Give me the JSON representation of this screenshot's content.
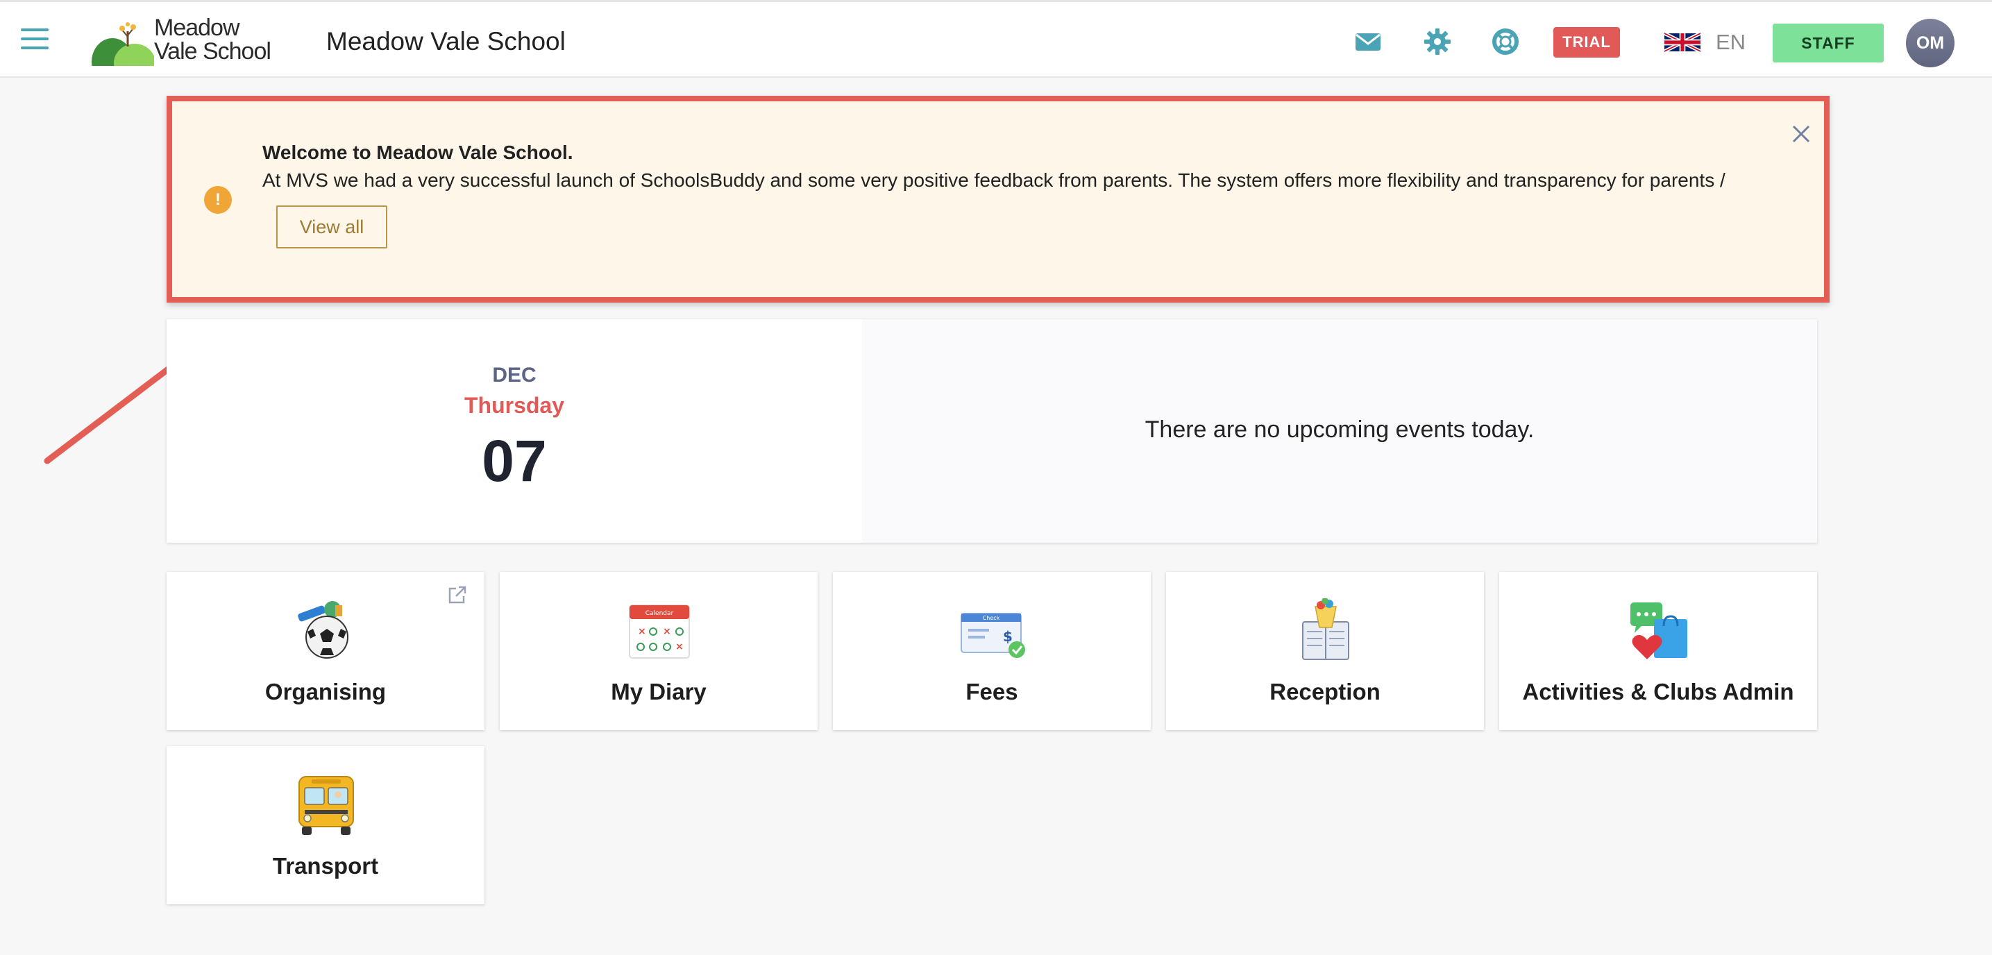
{
  "header": {
    "logo_line1": "Meadow",
    "logo_line2": "Vale School",
    "school_name": "Meadow Vale School",
    "icons": [
      "envelope-icon",
      "gear-icon",
      "lifebuoy-icon"
    ],
    "trial_label": "TRIAL",
    "language_flag": "uk-flag-icon",
    "language_code": "EN",
    "staff_label": "STAFF",
    "avatar_initials": "OM"
  },
  "banner": {
    "title": "Welcome to Meadow Vale School.",
    "text": "At MVS we had a very successful launch of SchoolsBuddy and some very positive feedback from parents. The system offers more flexibility and transparency for parents /",
    "view_all_label": "View all",
    "warning_icon_glyph": "!"
  },
  "date_panel": {
    "month": "DEC",
    "weekday": "Thursday",
    "day": "07",
    "events_message": "There are no upcoming events today."
  },
  "tiles": [
    {
      "label": "Organising",
      "icon": "sports-ball-icon"
    },
    {
      "label": "My Diary",
      "icon": "calendar-icon"
    },
    {
      "label": "Fees",
      "icon": "check-payment-icon"
    },
    {
      "label": "Reception",
      "icon": "reception-book-icon"
    },
    {
      "label": "Activities & Clubs Admin",
      "icon": "chat-shopping-icon"
    },
    {
      "label": "Transport",
      "icon": "school-bus-icon"
    }
  ],
  "calendar_header": "Calendar",
  "check_header": "Check",
  "colors": {
    "accent": "#4aa4b5",
    "trial": "#e15a57",
    "staff": "#7ee199",
    "banner_bg": "#fff6ea",
    "highlight": "#e35f55"
  }
}
